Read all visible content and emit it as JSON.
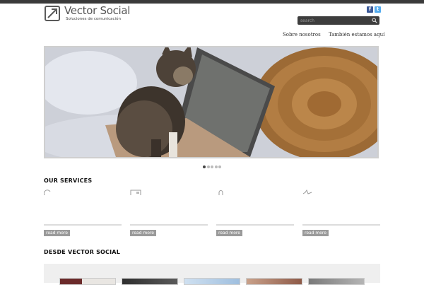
{
  "brand": {
    "title": "Vector Social",
    "subtitle": "Soluciones de comunicación"
  },
  "social": {
    "facebook_icon": "facebook-icon",
    "twitter_icon": "twitter-icon"
  },
  "search": {
    "placeholder": "search",
    "icon": "search-icon"
  },
  "nav": {
    "items": [
      "Sobre nosotros",
      "También estamos aquí"
    ]
  },
  "slider": {
    "slide_count": 5,
    "active_slide": 1
  },
  "services": {
    "heading": "OUR SERVICES",
    "items": [
      {
        "icon": "globe-icon",
        "link_label": "read more"
      },
      {
        "icon": "monitor-icon",
        "link_label": "read more"
      },
      {
        "icon": "pin-icon",
        "link_label": "read more"
      },
      {
        "icon": "chart-icon",
        "link_label": "read more"
      }
    ]
  },
  "blog": {
    "heading": "DESDE VECTOR SOCIAL"
  },
  "colors": {
    "topbar": "#3a3a3a",
    "search_bg": "#3d3d3d",
    "read_more_bg": "#9a9a9a",
    "dot_active": "#444444"
  }
}
